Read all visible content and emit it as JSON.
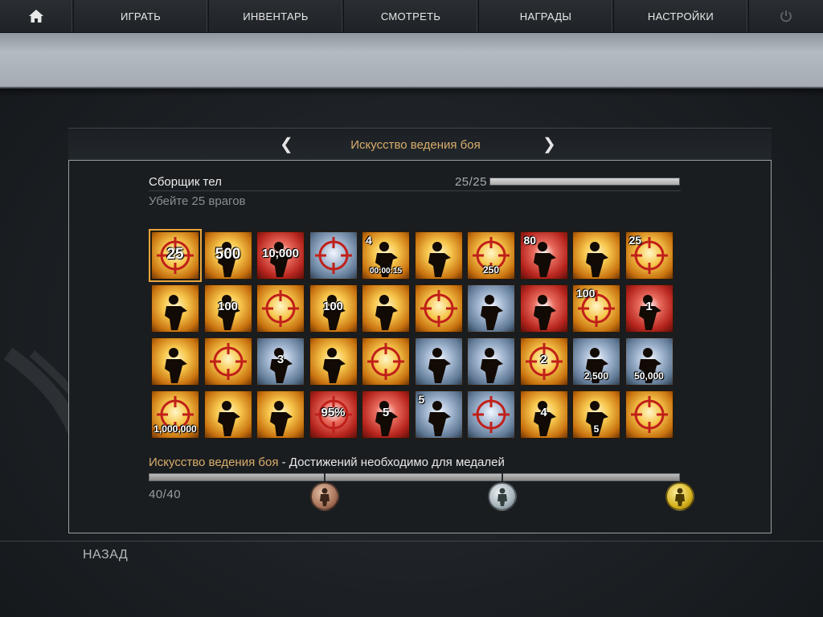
{
  "nav": {
    "home_icon": "home-icon",
    "items": [
      {
        "label": "ИГРАТЬ"
      },
      {
        "label": "ИНВЕНТАРЬ"
      },
      {
        "label": "СМОТРЕТЬ"
      },
      {
        "label": "НАГРАДЫ"
      },
      {
        "label": "НАСТРОЙКИ"
      }
    ],
    "power_icon": "power-icon"
  },
  "category": {
    "title": "Искусство ведения боя",
    "prev_arrow": "❮",
    "next_arrow": "❯"
  },
  "selected_achievement": {
    "name": "Сборщик тел",
    "description": "Убейте 25 врагов",
    "progress_text": "25/25",
    "progress": 1.0
  },
  "achievements": [
    {
      "style": "gold",
      "text": "25",
      "pos": "big",
      "selected": true
    },
    {
      "style": "gold",
      "text": "500",
      "pos": "big"
    },
    {
      "style": "red",
      "text": "10,000",
      "pos": ""
    },
    {
      "style": "blue",
      "text": "",
      "pos": ""
    },
    {
      "style": "gold",
      "text": "4",
      "pos": "corner",
      "text2": "00:00:15"
    },
    {
      "style": "gold",
      "text": "",
      "pos": ""
    },
    {
      "style": "gold",
      "text": "250",
      "pos": "bottom"
    },
    {
      "style": "red",
      "text": "80",
      "pos": "corner"
    },
    {
      "style": "gold",
      "text": "",
      "pos": ""
    },
    {
      "style": "gold",
      "text": "25",
      "pos": "corner"
    },
    {
      "style": "gold",
      "text": "",
      "pos": ""
    },
    {
      "style": "gold",
      "text": "100",
      "pos": ""
    },
    {
      "style": "gold",
      "text": "",
      "pos": ""
    },
    {
      "style": "gold",
      "text": "100",
      "pos": ""
    },
    {
      "style": "gold",
      "text": "",
      "pos": ""
    },
    {
      "style": "gold",
      "text": "",
      "pos": ""
    },
    {
      "style": "blue",
      "text": "",
      "pos": ""
    },
    {
      "style": "red",
      "text": "",
      "pos": ""
    },
    {
      "style": "gold",
      "text": "100",
      "pos": "corner"
    },
    {
      "style": "red",
      "text": "1",
      "pos": ""
    },
    {
      "style": "gold",
      "text": "",
      "pos": ""
    },
    {
      "style": "gold",
      "text": "",
      "pos": ""
    },
    {
      "style": "blue",
      "text": "3",
      "pos": ""
    },
    {
      "style": "gold",
      "text": "",
      "pos": ""
    },
    {
      "style": "gold",
      "text": "",
      "pos": ""
    },
    {
      "style": "blue",
      "text": "",
      "pos": ""
    },
    {
      "style": "blue",
      "text": "",
      "pos": ""
    },
    {
      "style": "gold",
      "text": "2",
      "pos": ""
    },
    {
      "style": "blue",
      "text": "2,500",
      "pos": "bottom"
    },
    {
      "style": "blue",
      "text": "50,000",
      "pos": "bottom"
    },
    {
      "style": "gold",
      "text": "1,000,000",
      "pos": "bottom"
    },
    {
      "style": "gold",
      "text": "",
      "pos": ""
    },
    {
      "style": "gold",
      "text": "",
      "pos": ""
    },
    {
      "style": "red",
      "text": "95%",
      "pos": ""
    },
    {
      "style": "red",
      "text": "5",
      "pos": ""
    },
    {
      "style": "blue",
      "text": "5",
      "pos": "corner"
    },
    {
      "style": "blue",
      "text": "",
      "pos": ""
    },
    {
      "style": "gold",
      "text": "4",
      "pos": ""
    },
    {
      "style": "gold",
      "text": "5",
      "pos": "bottom"
    },
    {
      "style": "gold",
      "text": "",
      "pos": ""
    }
  ],
  "medal_progress": {
    "category_label": "Искусство ведения боя",
    "rest_label": " - Достижений необходимо для медалей",
    "count_text": "40/40",
    "progress": 1.0,
    "medals": [
      "bronze",
      "silver",
      "gold"
    ],
    "medal_icons": [
      "bronze-medal-icon",
      "silver-medal-icon",
      "gold-medal-icon"
    ]
  },
  "footer": {
    "back_label": "НАЗАД"
  }
}
